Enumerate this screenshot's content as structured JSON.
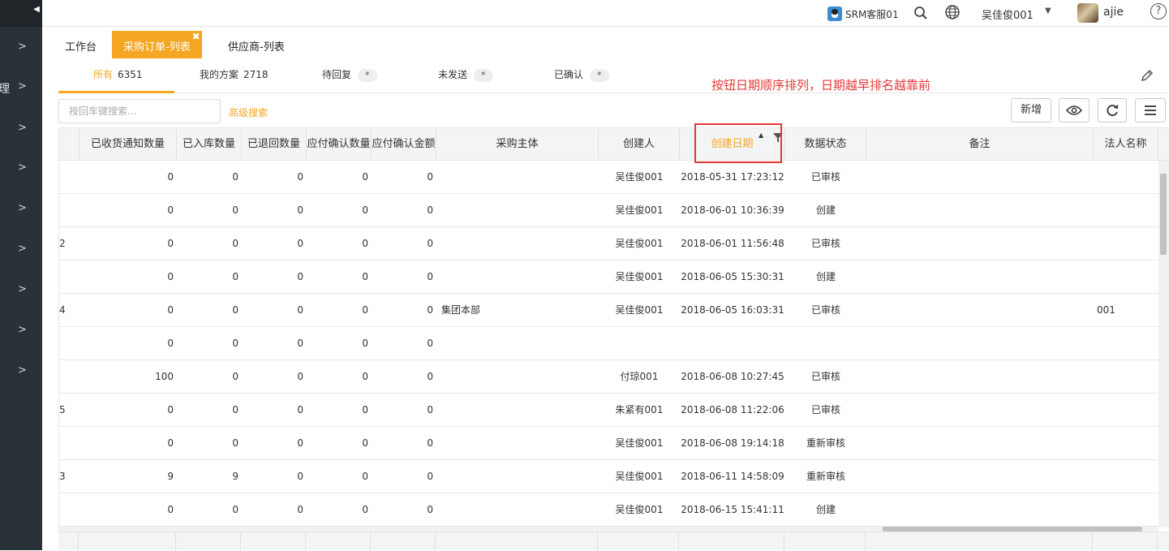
{
  "sidebar": {
    "collapse_glyph": "◀",
    "top_label": "理",
    "items": [
      {
        "label": "",
        "chevron": ">"
      },
      {
        "label": "理",
        "chevron": ">"
      },
      {
        "label": "",
        "chevron": ">"
      },
      {
        "label": "",
        "chevron": ">"
      },
      {
        "label": "",
        "chevron": ">"
      },
      {
        "label": "",
        "chevron": ">"
      },
      {
        "label": "",
        "chevron": ">"
      },
      {
        "label": "",
        "chevron": ">"
      },
      {
        "label": "",
        "chevron": ">"
      }
    ]
  },
  "header": {
    "service_label": "SRM客服01",
    "user_dropdown": "吴佳俊001",
    "username": "ajie",
    "help_glyph": "?"
  },
  "page_tabs": [
    {
      "label": "工作台",
      "active": false
    },
    {
      "label": "采购订单-列表",
      "active": true,
      "close": "✖"
    },
    {
      "label": "供应商-列表",
      "active": false
    }
  ],
  "sub_tabs": [
    {
      "label": "所有",
      "count": "6351",
      "active": true
    },
    {
      "label": "我的方案",
      "count": "2718",
      "active": false
    },
    {
      "label": "待回复",
      "pill": "*",
      "active": false
    },
    {
      "label": "未发送",
      "pill": "*",
      "active": false
    },
    {
      "label": "已确认",
      "pill": "*",
      "active": false
    }
  ],
  "annotation": "按钮日期顺序排列，日期越早排名越靠前",
  "toolbar": {
    "search_placeholder": "按回车键搜索...",
    "advanced_search": "高级搜索",
    "add_label": "新增"
  },
  "table": {
    "columns": [
      "",
      "已收货通知数量",
      "已入库数量",
      "已退回数量",
      "应付确认数量",
      "应付确认金额",
      "采购主体",
      "创建人",
      "创建日期",
      "数据状态",
      "备注",
      "法人名称"
    ],
    "sorted_column": "创建日期",
    "sort_direction": "asc",
    "rows": [
      {
        "id": "",
        "recv": "0",
        "stock": "0",
        "ret": "0",
        "payq": "0",
        "paya": "0",
        "entity": "",
        "creator": "吴佳俊001",
        "date": "2018-05-31 17:23:12",
        "status": "已审核",
        "remark": "",
        "legal": ""
      },
      {
        "id": "",
        "recv": "0",
        "stock": "0",
        "ret": "0",
        "payq": "0",
        "paya": "0",
        "entity": "",
        "creator": "吴佳俊001",
        "date": "2018-06-01 10:36:39",
        "status": "创建",
        "remark": "",
        "legal": ""
      },
      {
        "id": "2",
        "recv": "0",
        "stock": "0",
        "ret": "0",
        "payq": "0",
        "paya": "0",
        "entity": "",
        "creator": "吴佳俊001",
        "date": "2018-06-01 11:56:48",
        "status": "已审核",
        "remark": "",
        "legal": ""
      },
      {
        "id": "",
        "recv": "0",
        "stock": "0",
        "ret": "0",
        "payq": "0",
        "paya": "0",
        "entity": "",
        "creator": "吴佳俊001",
        "date": "2018-06-05 15:30:31",
        "status": "创建",
        "remark": "",
        "legal": ""
      },
      {
        "id": "4",
        "recv": "0",
        "stock": "0",
        "ret": "0",
        "payq": "0",
        "paya": "0",
        "entity": "集团本部",
        "creator": "吴佳俊001",
        "date": "2018-06-05 16:03:31",
        "status": "已审核",
        "remark": "",
        "legal": "001"
      },
      {
        "id": "",
        "recv": "0",
        "stock": "0",
        "ret": "0",
        "payq": "0",
        "paya": "0",
        "entity": "",
        "creator": "",
        "date": "",
        "status": "",
        "remark": "",
        "legal": ""
      },
      {
        "id": "",
        "recv": "100",
        "stock": "0",
        "ret": "0",
        "payq": "0",
        "paya": "0",
        "entity": "",
        "creator": "付琼001",
        "date": "2018-06-08 10:27:45",
        "status": "已审核",
        "remark": "",
        "legal": ""
      },
      {
        "id": "5",
        "recv": "0",
        "stock": "0",
        "ret": "0",
        "payq": "0",
        "paya": "0",
        "entity": "",
        "creator": "朱紧有001",
        "date": "2018-06-08 11:22:06",
        "status": "已审核",
        "remark": "",
        "legal": ""
      },
      {
        "id": "",
        "recv": "0",
        "stock": "0",
        "ret": "0",
        "payq": "0",
        "paya": "0",
        "entity": "",
        "creator": "吴佳俊001",
        "date": "2018-06-08 19:14:18",
        "status": "重新审核",
        "remark": "",
        "legal": ""
      },
      {
        "id": "3",
        "recv": "9",
        "stock": "9",
        "ret": "0",
        "payq": "0",
        "paya": "0",
        "entity": "",
        "creator": "吴佳俊001",
        "date": "2018-06-11 14:58:09",
        "status": "重新审核",
        "remark": "",
        "legal": ""
      },
      {
        "id": "",
        "recv": "0",
        "stock": "0",
        "ret": "0",
        "payq": "0",
        "paya": "0",
        "entity": "",
        "creator": "吴佳俊001",
        "date": "2018-06-15 15:41:11",
        "status": "创建",
        "remark": "",
        "legal": ""
      }
    ]
  },
  "colors": {
    "accent": "#f5a623",
    "annotation_red": "#e53935",
    "sidebar_bg": "#2b3237"
  }
}
